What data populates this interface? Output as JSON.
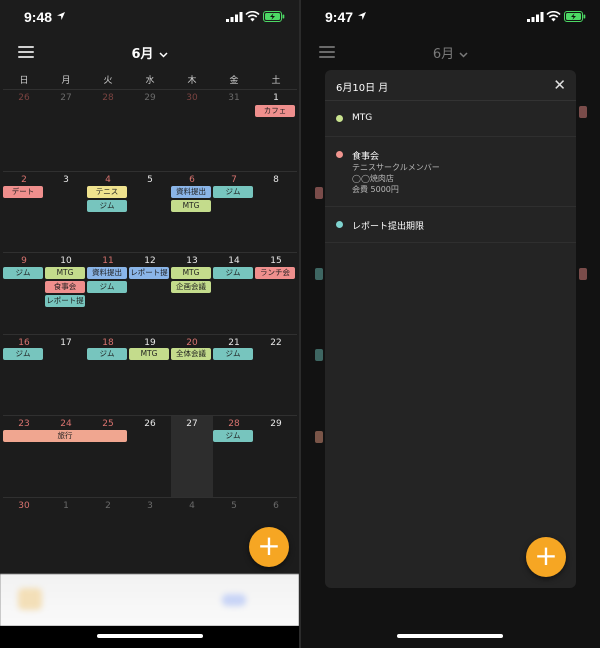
{
  "left_screen": {
    "status": {
      "time": "9:48"
    },
    "header": {
      "month": "6月",
      "chevron": "⌄"
    },
    "weekdays": [
      "日",
      "月",
      "火",
      "水",
      "木",
      "金",
      "土"
    ],
    "weeks": [
      [
        "26",
        "27",
        "28",
        "29",
        "30",
        "31",
        "1"
      ],
      [
        "2",
        "3",
        "4",
        "5",
        "6",
        "7",
        "8"
      ],
      [
        "9",
        "10",
        "11",
        "12",
        "13",
        "14",
        "15"
      ],
      [
        "16",
        "17",
        "18",
        "19",
        "20",
        "21",
        "22"
      ],
      [
        "23",
        "24",
        "25",
        "26",
        "27",
        "28",
        "29"
      ],
      [
        "30",
        "1",
        "2",
        "3",
        "4",
        "5",
        "6"
      ]
    ],
    "events": {
      "cafe": "カフェ",
      "date": "デート",
      "tennis": "テニス",
      "gym_4": "ジム",
      "shiryo_6": "資料提出",
      "mtg_6": "MTG",
      "gym_7": "ジム",
      "gym_9": "ジム",
      "mtg_10": "MTG",
      "shokuji_10": "食事会",
      "report_10": "レポート提",
      "shiryo_11": "資料提出",
      "gym_11": "ジム",
      "report_12": "レポート提",
      "mtg_13": "MTG",
      "kikaku_13": "企画会議",
      "gym_14": "ジム",
      "lunch_15": "ランチ会",
      "gym_16": "ジム",
      "gym_18": "ジム",
      "mtg_19": "MTG",
      "zentai_20": "全体会議",
      "gym_21": "ジム",
      "ryoko": "旅行",
      "gym_28": "ジム"
    },
    "fab_label": "+"
  },
  "right_screen": {
    "status": {
      "time": "9:47"
    },
    "header": {
      "month": "6月",
      "chevron": "⌄"
    },
    "panel": {
      "date_title": "6月10日 月",
      "close": "✕",
      "events": [
        {
          "title": "MTG",
          "color": "#c9e38f"
        },
        {
          "title": "食事会",
          "color": "#f0958f",
          "lines": [
            "テニスサークルメンバー",
            "◯◯焼肉店",
            "会費 5000円"
          ]
        },
        {
          "title": "レポート提出期限",
          "color": "#7fd3cf"
        }
      ]
    },
    "fab_label": "+"
  },
  "colors": {
    "green": "#c4dc8c",
    "teal": "#77c5be",
    "pink": "#ef8f8d",
    "yellow": "#efe28e",
    "blue": "#8ab5e8",
    "salmon": "#f0a690",
    "accent": "#f6a623"
  }
}
